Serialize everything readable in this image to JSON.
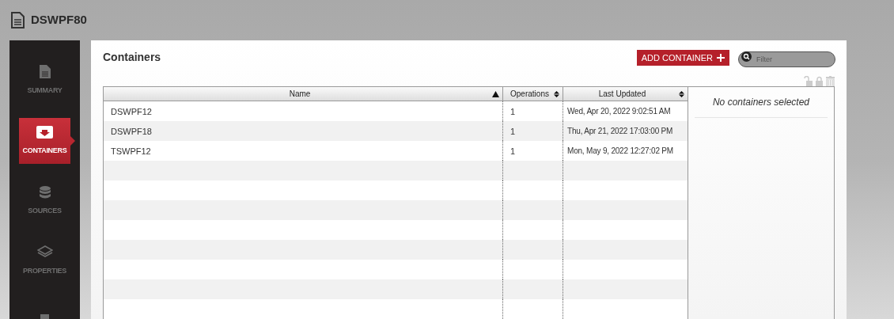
{
  "header": {
    "title": "DSWPF80"
  },
  "sidebar": {
    "items": [
      {
        "label": "SUMMARY",
        "selected": false
      },
      {
        "label": "CONTAINERS",
        "selected": true
      },
      {
        "label": "SOURCES",
        "selected": false
      },
      {
        "label": "PROPERTIES",
        "selected": false
      },
      {
        "selected": false
      }
    ]
  },
  "panel": {
    "title": "Containers",
    "add_button": "ADD CONTAINER",
    "filter": {
      "placeholder": "Filter"
    }
  },
  "table": {
    "columns": [
      {
        "label": "Name",
        "sorted": true
      },
      {
        "label": "Operations",
        "sorted": false
      },
      {
        "label": "Last Updated",
        "sorted": false
      }
    ],
    "rows": [
      [
        "DSWPF12",
        "1",
        "Wed, Apr 20, 2022 9:02:51 AM"
      ],
      [
        "DSWPF18",
        "1",
        "Thu, Apr 21, 2022 17:03:00 PM"
      ],
      [
        "TSWPF12",
        "1",
        "Mon, May 9, 2022 12:27:02 PM"
      ]
    ]
  },
  "details": {
    "message": "No containers selected"
  }
}
